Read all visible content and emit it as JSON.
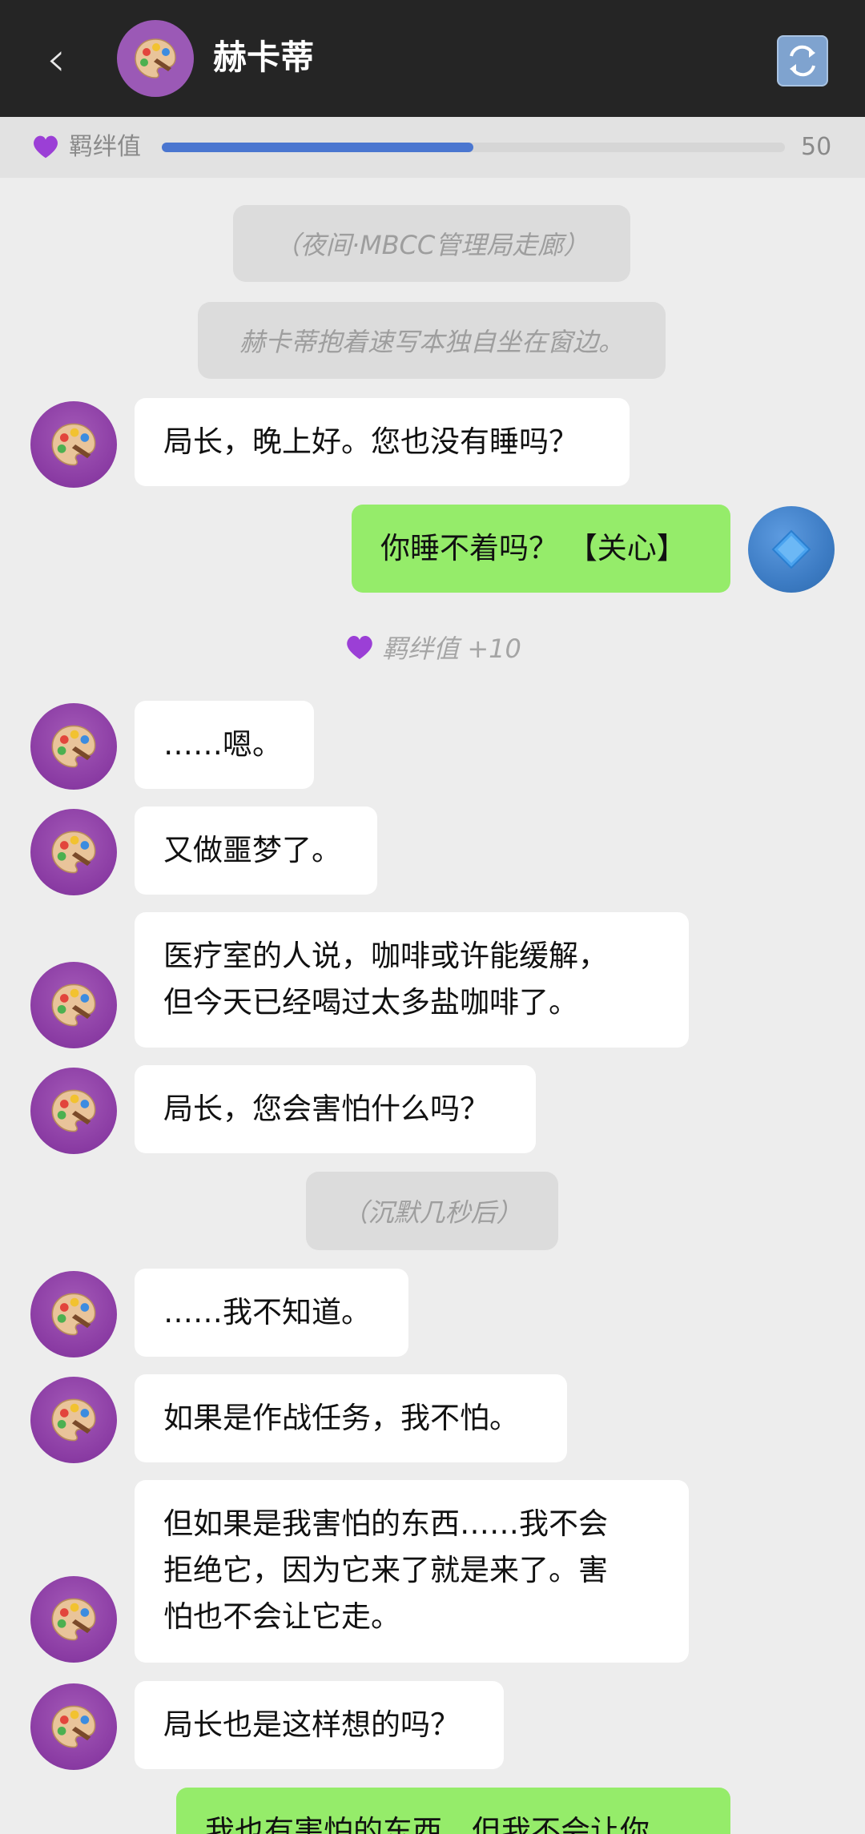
{
  "header": {
    "back_icon": "chevron-left-icon",
    "back_glyph": "‹",
    "title": "赫卡蒂",
    "avatar_icon": "palette-icon",
    "refresh_icon": "refresh-icon"
  },
  "bond": {
    "icon": "purple-heart-icon",
    "label": "羁绊值",
    "value": "50",
    "progress": 0.5
  },
  "messages": {
    "sys1": "（夜间·MBCC管理局走廊）",
    "sys2": "赫卡蒂抱着速写本独自坐在窗边。",
    "m1": "局长，晚上好。您也没有睡吗？",
    "u1": "你睡不着吗？ 【关心】",
    "bond_note": "羁绊值 +10",
    "m2": "……嗯。",
    "m3": "又做噩梦了。",
    "m4_line1": "医疗室的人说，咖啡或许能缓解，",
    "m4_line2": "但今天已经喝过太多盐咖啡了。",
    "m5": "局长，您会害怕什么吗？",
    "sys3": "（沉默几秒后）",
    "m6": "……我不知道。",
    "m7": "如果是作战任务，我不怕。",
    "m8_line1": "但如果是我害怕的东西……我不会",
    "m8_line2": "拒绝它，因为它来了就是来了。害",
    "m8_line3": "怕也不会让它走。",
    "m9": "局长也是这样想的吗？",
    "u2": "我也有害怕的东西，但我不会让你"
  },
  "colors": {
    "header_bg": "#252525",
    "bubble_npc": "#ffffff",
    "bubble_user": "#95ec6a",
    "bond_fill": "#4a76d0",
    "avatar_purple": "#8a3ba3"
  }
}
